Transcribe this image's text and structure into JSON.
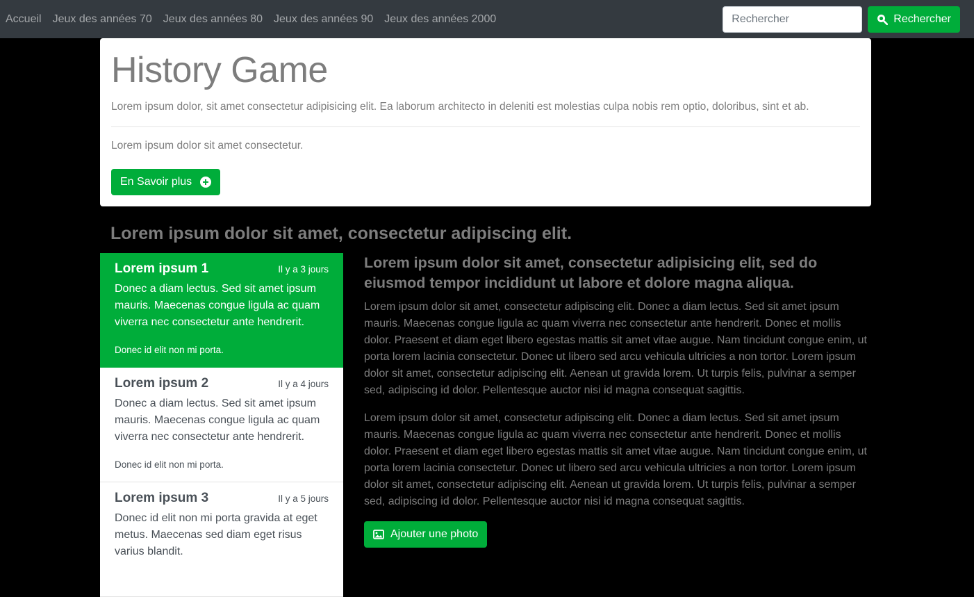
{
  "navbar": {
    "links": [
      "Accueil",
      "Jeux des années 70",
      "Jeux des années 80",
      "Jeux des années 90",
      "Jeux des années 2000"
    ],
    "search_placeholder": "Rechercher",
    "search_button": "Rechercher",
    "search_icon": "search-icon"
  },
  "jumbotron": {
    "title": "History Game",
    "lead": "Lorem ipsum dolor, sit amet consectetur adipisicing elit. Ea laborum architecto in deleniti est molestias culpa nobis rem optio, doloribus, sint et ab.",
    "text": "Lorem ipsum dolor sit amet consectetur.",
    "button": "En Savoir plus",
    "button_icon": "plus-circle-icon"
  },
  "section_heading": "Lorem ipsum dolor sit amet, consectetur adipiscing elit.",
  "list": [
    {
      "title": "Lorem ipsum 1",
      "time": "Il y a 3 jours",
      "body": "Donec a diam lectus. Sed sit amet ipsum mauris. Maecenas congue ligula ac quam viverra nec consectetur ante hendrerit.",
      "foot": "Donec id elit non mi porta.",
      "active": true
    },
    {
      "title": "Lorem ipsum 2",
      "time": "Il y a 4 jours",
      "body": "Donec a diam lectus. Sed sit amet ipsum mauris. Maecenas congue ligula ac quam viverra nec consectetur ante hendrerit.",
      "foot": "Donec id elit non mi porta.",
      "active": false
    },
    {
      "title": "Lorem ipsum 3",
      "time": "Il y a 5 jours",
      "body": "Donec id elit non mi porta gravida at eget metus. Maecenas sed diam eget risus varius blandit.",
      "foot": "",
      "active": false
    }
  ],
  "content": {
    "title": "Lorem ipsum dolor sit amet, consectetur adipisicing elit, sed do eiusmod tempor incididunt ut labore et dolore magna aliqua.",
    "paragraphs": [
      "Lorem ipsum dolor sit amet, consectetur adipiscing elit. Donec a diam lectus. Sed sit amet ipsum mauris. Maecenas congue ligula ac quam viverra nec consectetur ante hendrerit. Donec et mollis dolor. Praesent et diam eget libero egestas mattis sit amet vitae augue. Nam tincidunt congue enim, ut porta lorem lacinia consectetur. Donec ut libero sed arcu vehicula ultricies a non tortor. Lorem ipsum dolor sit amet, consectetur adipiscing elit. Aenean ut gravida lorem. Ut turpis felis, pulvinar a semper sed, adipiscing id dolor. Pellentesque auctor nisi id magna consequat sagittis.",
      "Lorem ipsum dolor sit amet, consectetur adipiscing elit. Donec a diam lectus. Sed sit amet ipsum mauris. Maecenas congue ligula ac quam viverra nec consectetur ante hendrerit. Donec et mollis dolor. Praesent et diam eget libero egestas mattis sit amet vitae augue. Nam tincidunt congue enim, ut porta lorem lacinia consectetur. Donec ut libero sed arcu vehicula ultricies a non tortor. Lorem ipsum dolor sit amet, consectetur adipiscing elit. Aenean ut gravida lorem. Ut turpis felis, pulvinar a semper sed, adipiscing id dolor. Pellentesque auctor nisi id magna consequat sagittis."
    ],
    "button": "Ajouter une photo",
    "button_icon": "image-icon"
  },
  "colors": {
    "navbar_bg": "#343a40",
    "accent_green": "#00ad3a",
    "page_bg": "#000000",
    "muted_text": "#7d7d7d"
  }
}
